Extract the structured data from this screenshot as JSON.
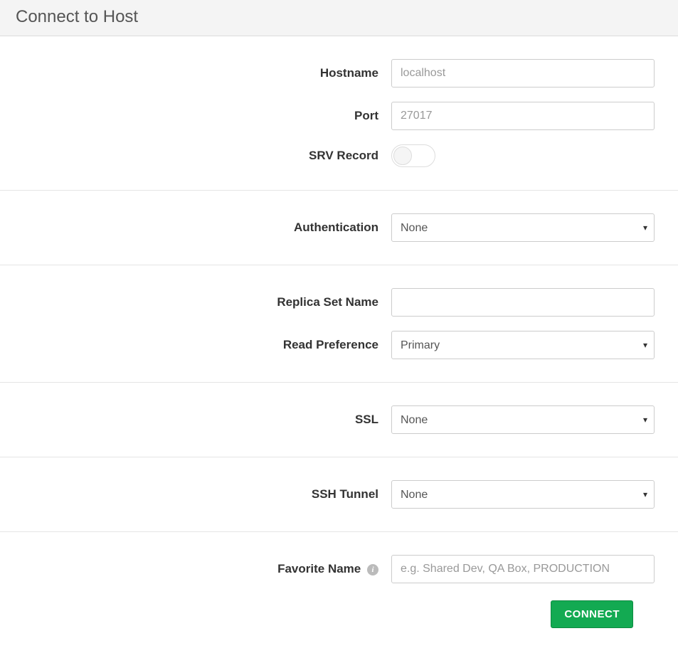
{
  "header": {
    "title": "Connect to Host"
  },
  "fields": {
    "hostname": {
      "label": "Hostname",
      "placeholder": "localhost",
      "value": ""
    },
    "port": {
      "label": "Port",
      "placeholder": "27017",
      "value": ""
    },
    "srv": {
      "label": "SRV Record",
      "value": false
    },
    "authentication": {
      "label": "Authentication",
      "value": "None"
    },
    "replicaSet": {
      "label": "Replica Set Name",
      "value": ""
    },
    "readPreference": {
      "label": "Read Preference",
      "value": "Primary"
    },
    "ssl": {
      "label": "SSL",
      "value": "None"
    },
    "sshTunnel": {
      "label": "SSH Tunnel",
      "value": "None"
    },
    "favoriteName": {
      "label": "Favorite Name",
      "placeholder": "e.g. Shared Dev, QA Box, PRODUCTION",
      "value": ""
    }
  },
  "buttons": {
    "connect": "CONNECT"
  }
}
